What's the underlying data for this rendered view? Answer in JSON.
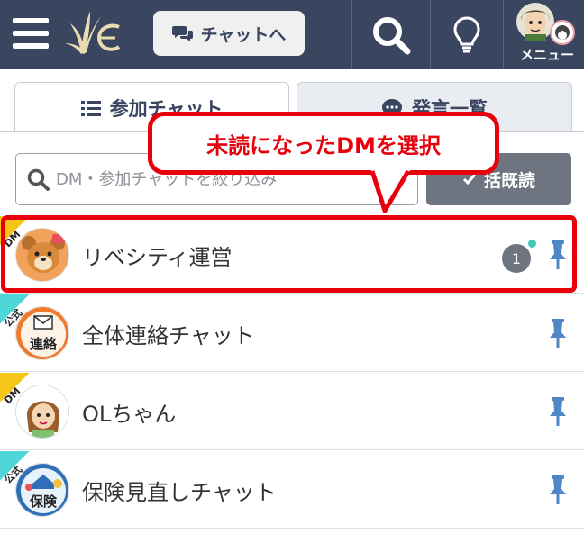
{
  "header": {
    "chat_button_label": "チャットへ",
    "menu_label": "メニュー",
    "background_color": "#3a4560"
  },
  "tabs": [
    {
      "label": "参加チャット",
      "icon": "list-icon",
      "active": true
    },
    {
      "label": "発言一覧",
      "icon": "speech-bubble-icon",
      "active": false
    }
  ],
  "search": {
    "placeholder": "DM・参加チャットを絞り込み"
  },
  "read_all_button": {
    "label": "括既読"
  },
  "chats": [
    {
      "tag": "DM",
      "tag_color": "#f5c518",
      "name": "リベシティ運営",
      "unread_count": "1",
      "pinned": true
    },
    {
      "tag": "公式",
      "tag_color": "#4fd6d6",
      "name": "全体連絡チャット",
      "pinned": true
    },
    {
      "tag": "DM",
      "tag_color": "#f5c518",
      "name": "OLちゃん",
      "pinned": true
    },
    {
      "tag": "公式",
      "tag_color": "#4fd6d6",
      "name": "保険見直しチャット",
      "pinned": true
    }
  ],
  "callout": {
    "text": "未読になったDMを選択",
    "color": "#e8000b"
  },
  "avatar_texts": {
    "renraku": "連絡",
    "hoken": "保険"
  }
}
